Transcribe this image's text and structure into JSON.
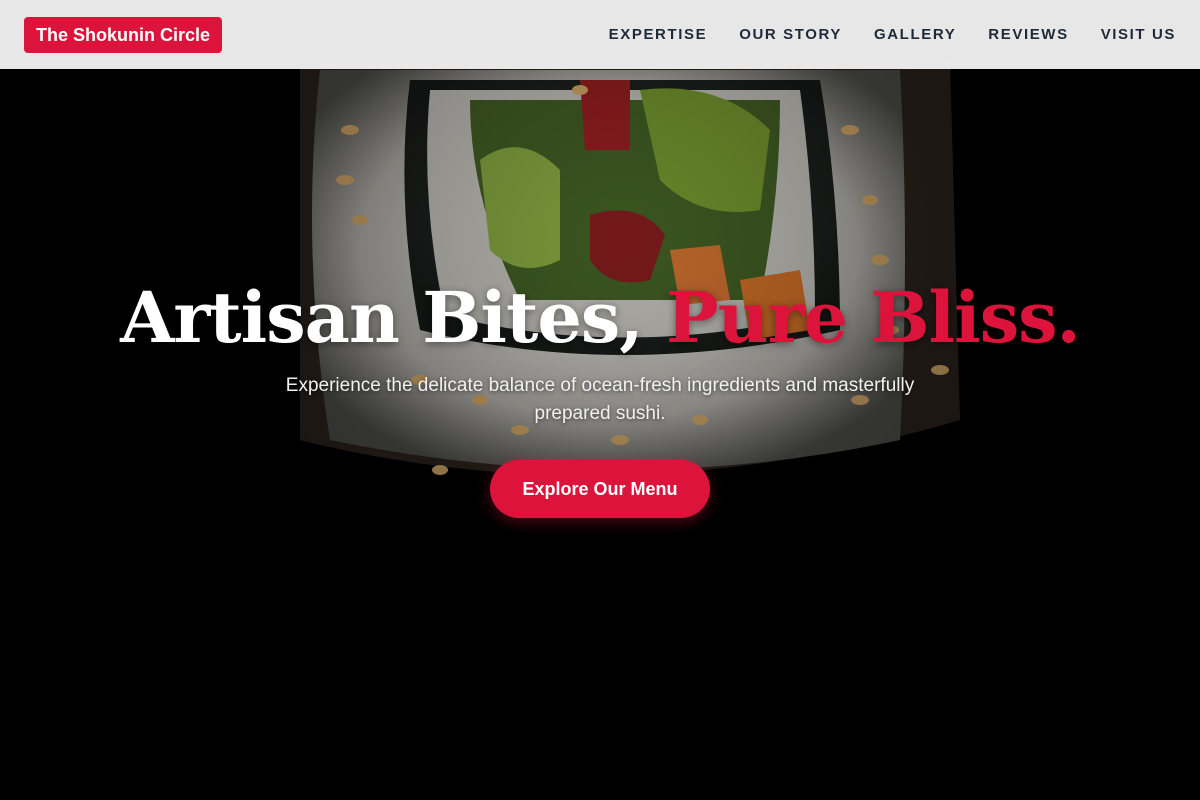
{
  "header": {
    "brand": "The Shokunin Circle",
    "nav": [
      {
        "label": "EXPERTISE"
      },
      {
        "label": "OUR STORY"
      },
      {
        "label": "GALLERY"
      },
      {
        "label": "REVIEWS"
      },
      {
        "label": "VISIT US"
      }
    ]
  },
  "hero": {
    "headline_main": "Artisan Bites, ",
    "headline_accent": "Pure Bliss.",
    "subtitle": "Experience the delicate balance of ocean-fresh ingredients and masterfully prepared sushi.",
    "cta_label": "Explore Our Menu",
    "background_image": "sushi-roll-photo"
  },
  "colors": {
    "accent": "#dc143c",
    "header_bg": "#f5f5f5",
    "nav_text": "#1f2937",
    "hero_bg": "#000000"
  }
}
